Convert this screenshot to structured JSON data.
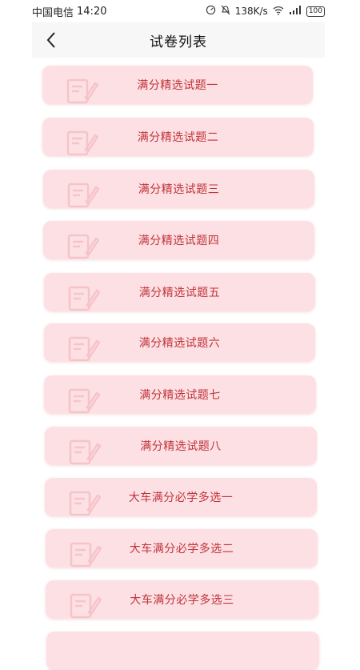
{
  "status_bar": {
    "carrier": "中国电信",
    "time": "14:20",
    "speed": "138K/s",
    "network": "4G",
    "battery": "100"
  },
  "header": {
    "title": "试卷列表"
  },
  "papers": [
    {
      "label": "满分精选试题一"
    },
    {
      "label": "满分精选试题二"
    },
    {
      "label": "满分精选试题三"
    },
    {
      "label": "满分精选试题四"
    },
    {
      "label": "满分精选试题五"
    },
    {
      "label": "满分精选试题六"
    },
    {
      "label": "满分精选试题七"
    },
    {
      "label": "满分精选试题八"
    },
    {
      "label": "大车满分必学多选一"
    },
    {
      "label": "大车满分必学多选二"
    },
    {
      "label": "大车满分必学多选三"
    },
    {
      "label": ""
    }
  ],
  "colors": {
    "card_bg": "#fde0e3",
    "card_text": "#c0333b"
  }
}
